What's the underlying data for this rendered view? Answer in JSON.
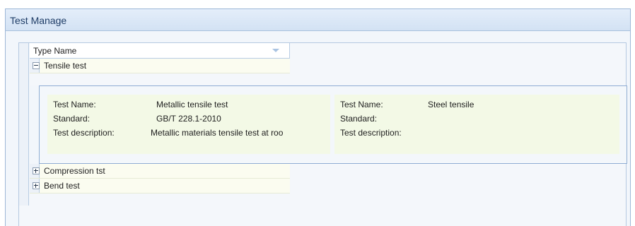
{
  "window": {
    "title": "Test Manage"
  },
  "grid": {
    "column_header": "Type Name",
    "groups": [
      {
        "label": "Tensile test",
        "expanded": true
      },
      {
        "label": "Compression tst",
        "expanded": false
      },
      {
        "label": "Bend test",
        "expanded": false
      }
    ],
    "cards": [
      {
        "fields": [
          {
            "label": "Test Name:",
            "value": "Metallic tensile test"
          },
          {
            "label": "Standard:",
            "value": "GB/T 228.1-2010"
          },
          {
            "label": "Test description:",
            "value": "Metallic materials tensile test at roo"
          }
        ]
      },
      {
        "fields": [
          {
            "label": "Test Name:",
            "value": "Steel tensile"
          },
          {
            "label": "Standard:",
            "value": ""
          },
          {
            "label": "Test description:",
            "value": ""
          }
        ]
      }
    ]
  },
  "colors": {
    "title_bar": "#d3e2f4",
    "card_background": "#f3f9e6",
    "group_row_background": "#fbfcf0",
    "border_accent": "#8fadd3"
  }
}
